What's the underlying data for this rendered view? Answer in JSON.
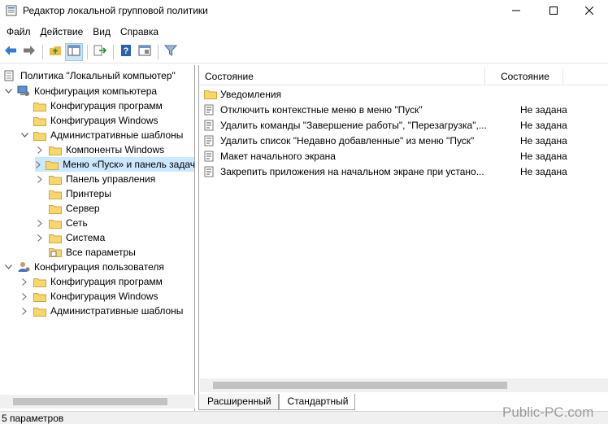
{
  "window": {
    "title": "Редактор локальной групповой политики",
    "controls": {
      "minimize": "minimize-icon",
      "maximize": "maximize-icon",
      "close": "close-icon"
    }
  },
  "menu": [
    "Файл",
    "Действие",
    "Вид",
    "Справка"
  ],
  "toolbar": [
    "back-icon",
    "forward-icon",
    "up-folder-icon",
    "show-hide-tree-icon",
    "export-list-icon",
    "help-icon",
    "properties-icon",
    "filter-icon"
  ],
  "tree": [
    {
      "label": "Политика \"Локальный компьютер\"",
      "icon": "policy-icon",
      "expander": ""
    },
    {
      "label": "Конфигурация компьютера",
      "icon": "computer-icon",
      "expander": "collapse"
    },
    {
      "label": "Конфигурация программ",
      "icon": "folder-icon",
      "expander": ""
    },
    {
      "label": "Конфигурация Windows",
      "icon": "folder-icon",
      "expander": ""
    },
    {
      "label": "Административные шаблоны",
      "icon": "folder-icon",
      "expander": "collapse"
    },
    {
      "label": "Компоненты Windows",
      "icon": "folder-icon",
      "expander": "expand"
    },
    {
      "label": "Меню «Пуск» и панель задач",
      "icon": "folder-icon",
      "expander": "expand",
      "selected": true
    },
    {
      "label": "Панель управления",
      "icon": "folder-icon",
      "expander": "expand"
    },
    {
      "label": "Принтеры",
      "icon": "folder-icon",
      "expander": ""
    },
    {
      "label": "Сервер",
      "icon": "folder-icon",
      "expander": ""
    },
    {
      "label": "Сеть",
      "icon": "folder-icon",
      "expander": "expand"
    },
    {
      "label": "Система",
      "icon": "folder-icon",
      "expander": "expand"
    },
    {
      "label": "Все параметры",
      "icon": "all-settings-icon",
      "expander": ""
    },
    {
      "label": "Конфигурация пользователя",
      "icon": "user-icon",
      "expander": "collapse"
    },
    {
      "label": "Конфигурация программ",
      "icon": "folder-icon",
      "expander": "expand"
    },
    {
      "label": "Конфигурация Windows",
      "icon": "folder-icon",
      "expander": "expand"
    },
    {
      "label": "Административные шаблоны",
      "icon": "folder-icon",
      "expander": "expand"
    }
  ],
  "list": {
    "columns": {
      "name": "Состояние",
      "state": "Состояние"
    },
    "rows": [
      {
        "name": "Уведомления",
        "state": "",
        "icon": "folder-icon"
      },
      {
        "name": "Отключить контекстные меню в меню \"Пуск\"",
        "state": "Не задана",
        "icon": "setting-icon"
      },
      {
        "name": "Удалить команды \"Завершение работы\", \"Перезагрузка\",...",
        "state": "Не задана",
        "icon": "setting-icon"
      },
      {
        "name": "Удалить список \"Недавно добавленные\" из меню \"Пуск\"",
        "state": "Не задана",
        "icon": "setting-icon"
      },
      {
        "name": "Макет начального экрана",
        "state": "Не задана",
        "icon": "setting-icon"
      },
      {
        "name": "Закрепить приложения на начальном экране при устано...",
        "state": "Не задана",
        "icon": "setting-icon"
      }
    ]
  },
  "tabs": [
    "Расширенный",
    "Стандартный"
  ],
  "status": "5 параметров",
  "watermark": "Public-PC.com",
  "colors": {
    "selection": "#cce8ff",
    "folder": "#f7d76b",
    "accent": "#0078d7"
  }
}
